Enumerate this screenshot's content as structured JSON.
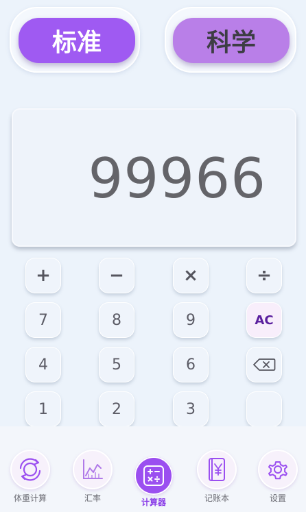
{
  "modes": {
    "standard_label": "标准",
    "scientific_label": "科学",
    "active": "standard"
  },
  "display": {
    "value": "99966"
  },
  "keys": {
    "row1": [
      "+",
      "−",
      "×",
      "÷"
    ],
    "row2": [
      "7",
      "8",
      "9",
      "AC"
    ],
    "row3": [
      "4",
      "5",
      "6"
    ],
    "row4": [
      "1",
      "2",
      "3",
      ""
    ]
  },
  "nav": {
    "items": [
      {
        "label": "体重计算",
        "icon": "refresh-circle-icon"
      },
      {
        "label": "汇率",
        "icon": "line-chart-icon"
      },
      {
        "label": "计算器",
        "icon": "calculator-icon"
      },
      {
        "label": "记账本",
        "icon": "yen-book-icon"
      },
      {
        "label": "设置",
        "icon": "gear-icon"
      }
    ],
    "active_index": 2
  },
  "colors": {
    "accent": "#9f5af2",
    "background": "#ecf3fb",
    "display_text": "#646469"
  }
}
